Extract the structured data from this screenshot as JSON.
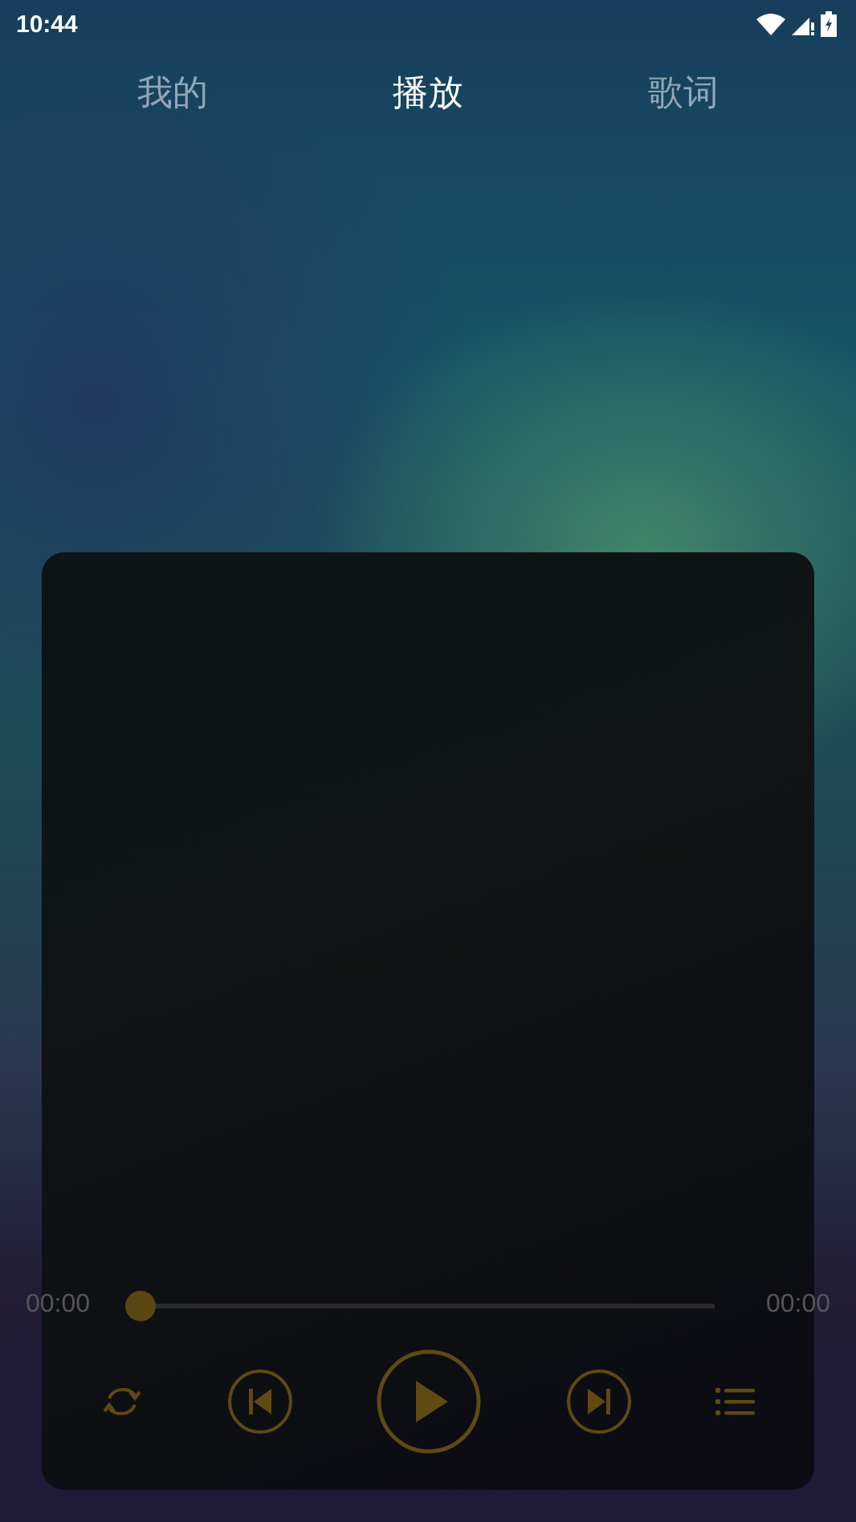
{
  "status_bar": {
    "time": "10:44"
  },
  "tabs": [
    {
      "label": "我的",
      "selected": false
    },
    {
      "label": "播放",
      "selected": true
    },
    {
      "label": "歌词",
      "selected": false
    }
  ],
  "player": {
    "elapsed": "00:00",
    "duration": "00:00",
    "progress": {
      "level": 0
    }
  }
}
